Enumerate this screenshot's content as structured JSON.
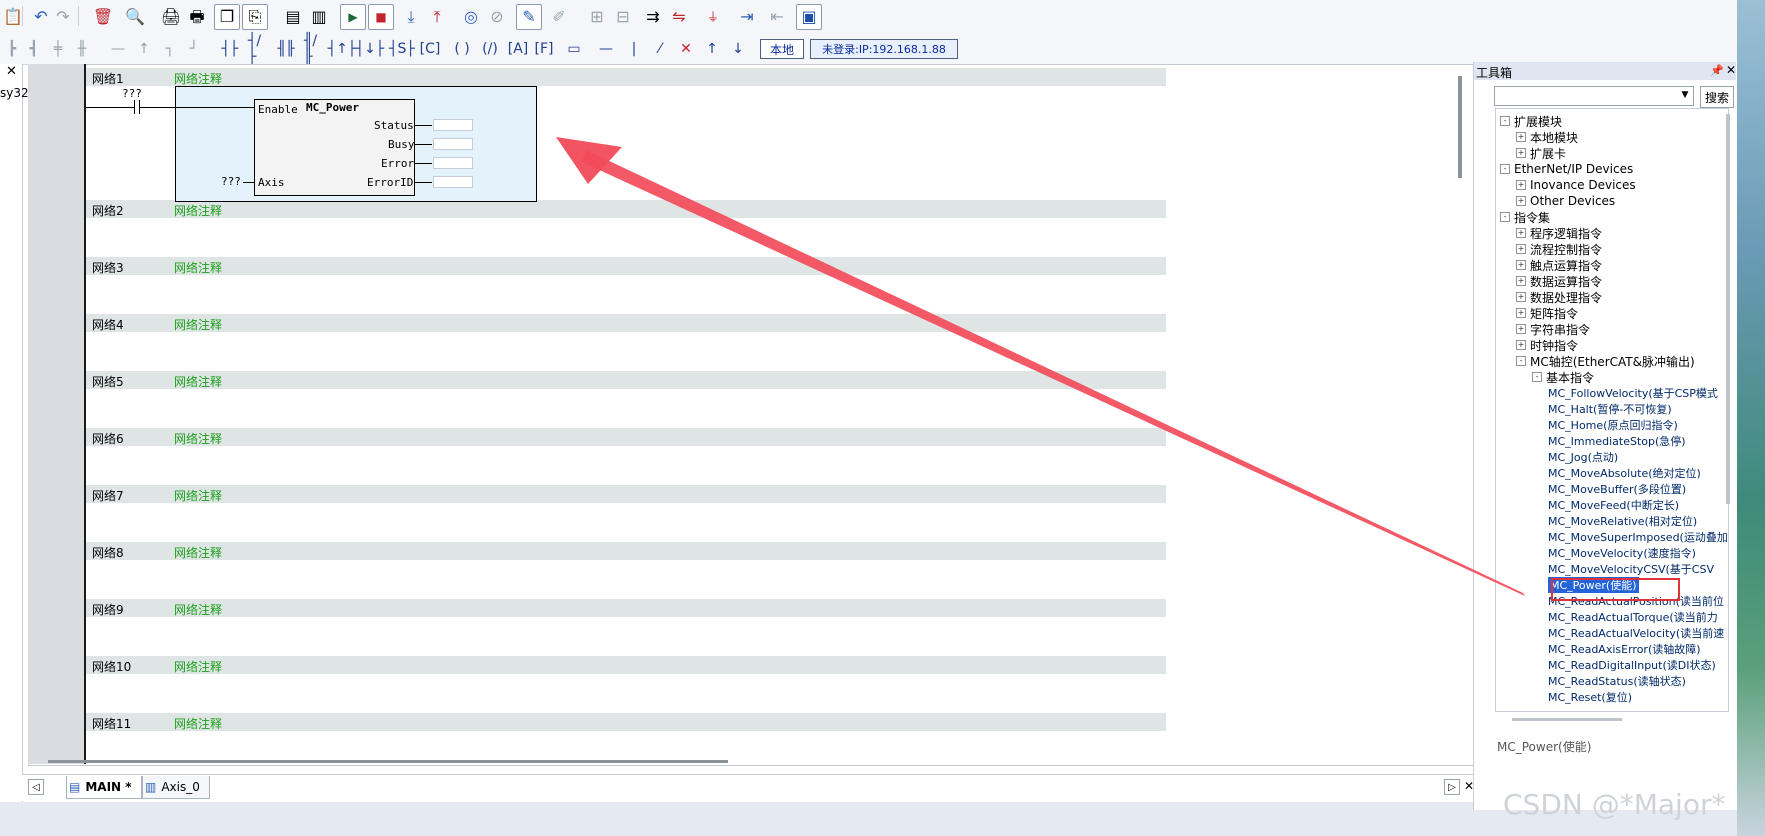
{
  "toolbar": {
    "local_button": "本地",
    "login_button": "未登录:IP:192.168.1.88"
  },
  "left_panel": {
    "close": "✕",
    "label": "sy32"
  },
  "networks": [
    {
      "label": "网络1",
      "comment": "网络注释"
    },
    {
      "label": "网络2",
      "comment": "网络注释"
    },
    {
      "label": "网络3",
      "comment": "网络注释"
    },
    {
      "label": "网络4",
      "comment": "网络注释"
    },
    {
      "label": "网络5",
      "comment": "网络注释"
    },
    {
      "label": "网络6",
      "comment": "网络注释"
    },
    {
      "label": "网络7",
      "comment": "网络注释"
    },
    {
      "label": "网络8",
      "comment": "网络注释"
    },
    {
      "label": "网络9",
      "comment": "网络注释"
    },
    {
      "label": "网络10",
      "comment": "网络注释"
    },
    {
      "label": "网络11",
      "comment": "网络注释"
    }
  ],
  "function_block": {
    "contact_var": "???",
    "axis_var": "???",
    "enable_pin": "Enable",
    "name": "MC_Power",
    "axis_pin": "Axis",
    "outputs": [
      "Status",
      "Busy",
      "Error",
      "ErrorID"
    ]
  },
  "tabs": [
    {
      "label": "MAIN *"
    },
    {
      "label": "Axis_0"
    }
  ],
  "toolbox": {
    "title": "工具箱",
    "search_button": "搜索",
    "tree": [
      {
        "label": "扩展模块",
        "level": 0,
        "state": "-"
      },
      {
        "label": "本地模块",
        "level": 1,
        "state": "+"
      },
      {
        "label": "扩展卡",
        "level": 1,
        "state": "+"
      },
      {
        "label": "EtherNet/IP Devices",
        "level": 0,
        "state": "-"
      },
      {
        "label": "Inovance Devices",
        "level": 1,
        "state": "+"
      },
      {
        "label": "Other Devices",
        "level": 1,
        "state": "+"
      },
      {
        "label": "指令集",
        "level": 0,
        "state": "-"
      },
      {
        "label": "程序逻辑指令",
        "level": 1,
        "state": "+"
      },
      {
        "label": "流程控制指令",
        "level": 1,
        "state": "+"
      },
      {
        "label": "触点运算指令",
        "level": 1,
        "state": "+"
      },
      {
        "label": "数据运算指令",
        "level": 1,
        "state": "+"
      },
      {
        "label": "数据处理指令",
        "level": 1,
        "state": "+"
      },
      {
        "label": "矩阵指令",
        "level": 1,
        "state": "+"
      },
      {
        "label": "字符串指令",
        "level": 1,
        "state": "+"
      },
      {
        "label": "时钟指令",
        "level": 1,
        "state": "+"
      },
      {
        "label": "MC轴控(EtherCAT&脉冲输出)",
        "level": 1,
        "state": "-"
      },
      {
        "label": "基本指令",
        "level": 2,
        "state": "-"
      },
      {
        "label": "MC_FollowVelocity(基于CSP模式",
        "level": 3,
        "state": ""
      },
      {
        "label": "MC_Halt(暂停-不可恢复)",
        "level": 3,
        "state": ""
      },
      {
        "label": "MC_Home(原点回归指令)",
        "level": 3,
        "state": ""
      },
      {
        "label": "MC_ImmediateStop(急停)",
        "level": 3,
        "state": ""
      },
      {
        "label": "MC_Jog(点动)",
        "level": 3,
        "state": ""
      },
      {
        "label": "MC_MoveAbsolute(绝对定位)",
        "level": 3,
        "state": ""
      },
      {
        "label": "MC_MoveBuffer(多段位置)",
        "level": 3,
        "state": ""
      },
      {
        "label": "MC_MoveFeed(中断定长)",
        "level": 3,
        "state": ""
      },
      {
        "label": "MC_MoveRelative(相对定位)",
        "level": 3,
        "state": ""
      },
      {
        "label": "MC_MoveSuperImposed(运动叠加",
        "level": 3,
        "state": ""
      },
      {
        "label": "MC_MoveVelocity(速度指令)",
        "level": 3,
        "state": ""
      },
      {
        "label": "MC_MoveVelocityCSV(基于CSV",
        "level": 3,
        "state": ""
      },
      {
        "label": "MC_Power(使能)",
        "level": 3,
        "state": "",
        "selected": true
      },
      {
        "label": "MC_ReadActualPosition(读当前位",
        "level": 3,
        "state": ""
      },
      {
        "label": "MC_ReadActualTorque(读当前力",
        "level": 3,
        "state": ""
      },
      {
        "label": "MC_ReadActualVelocity(读当前速",
        "level": 3,
        "state": ""
      },
      {
        "label": "MC_ReadAxisError(读轴故障)",
        "level": 3,
        "state": ""
      },
      {
        "label": "MC_ReadDigitalInput(读DI状态)",
        "level": 3,
        "state": ""
      },
      {
        "label": "MC_ReadStatus(读轴状态)",
        "level": 3,
        "state": ""
      },
      {
        "label": "MC_Reset(复位)",
        "level": 3,
        "state": ""
      }
    ],
    "description": "MC_Power(使能)"
  },
  "watermark": "CSDN @*Major*"
}
